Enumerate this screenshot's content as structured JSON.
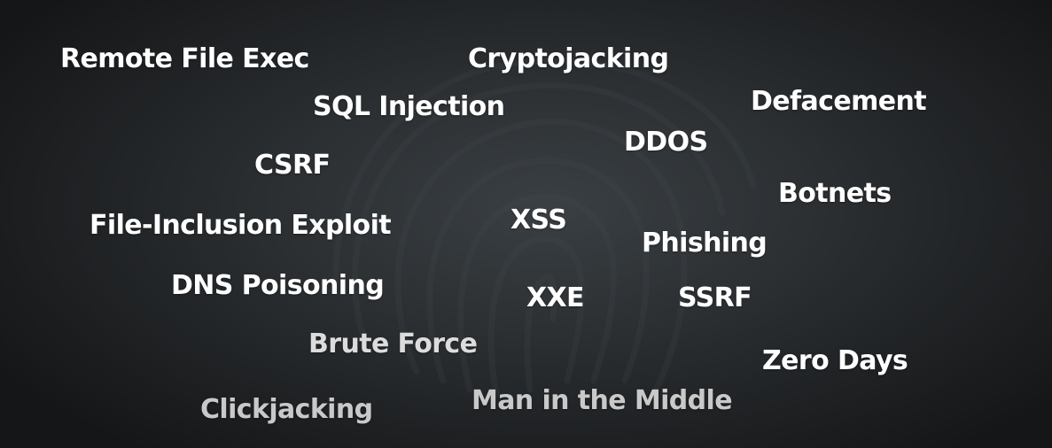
{
  "colors": {
    "background": "#2b2f32",
    "text": "#ffffff",
    "text_dim": "#dcdcdc"
  },
  "background_icon": "fingerprint-icon",
  "terms": [
    "Remote File Exec",
    "Cryptojacking",
    "SQL Injection",
    "Defacement",
    "DDOS",
    "CSRF",
    "Botnets",
    "File-Inclusion Exploit",
    "XSS",
    "Phishing",
    "DNS Poisoning",
    "XXE",
    "SSRF",
    "Brute Force",
    "Zero Days",
    "Man in the Middle",
    "Clickjacking"
  ]
}
